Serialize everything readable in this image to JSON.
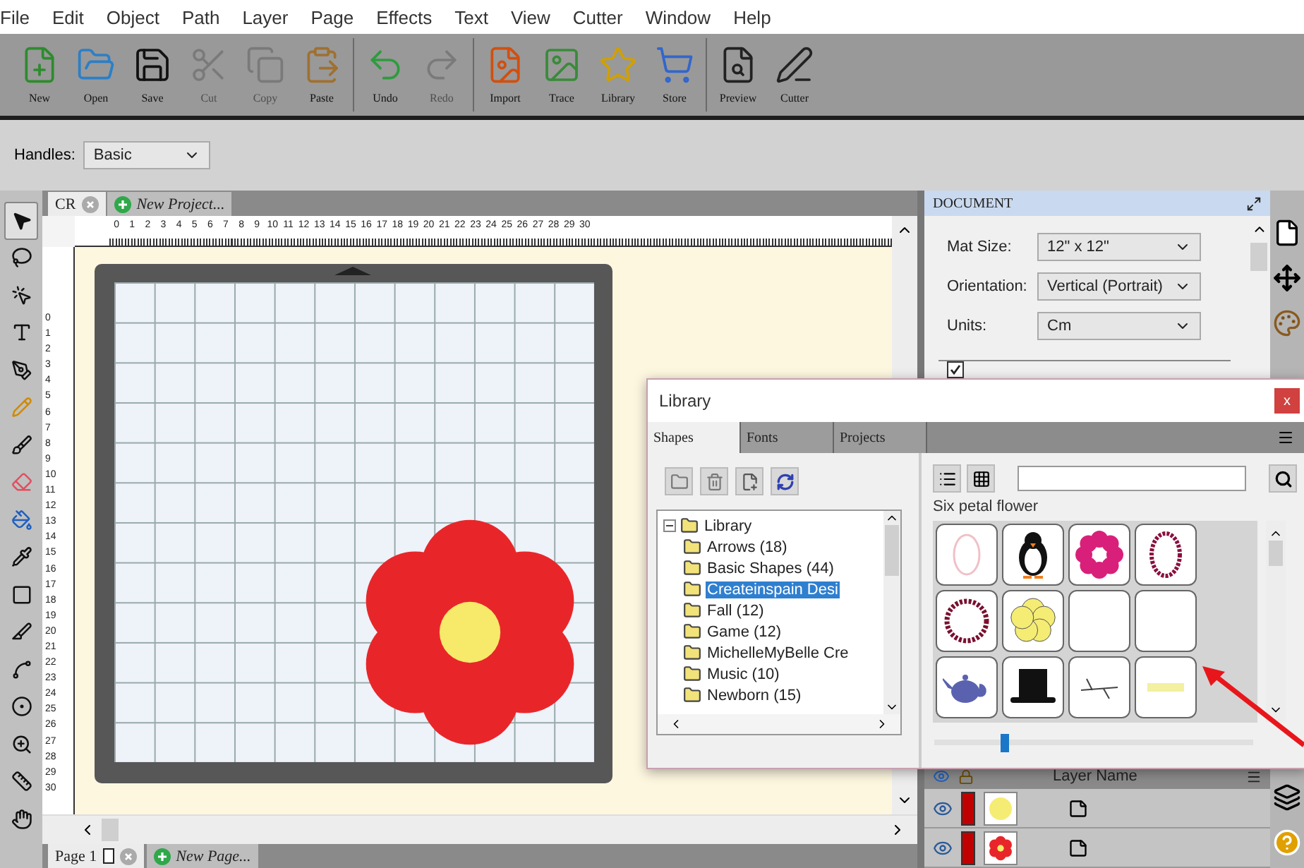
{
  "menu": [
    "File",
    "Edit",
    "Object",
    "Path",
    "Layer",
    "Page",
    "Effects",
    "Text",
    "View",
    "Cutter",
    "Window",
    "Help"
  ],
  "toolbar": {
    "groups": [
      {
        "buttons": [
          {
            "label": "New",
            "disabled": false
          },
          {
            "label": "Open",
            "disabled": false
          },
          {
            "label": "Save",
            "disabled": false
          },
          {
            "label": "Cut",
            "disabled": true
          },
          {
            "label": "Copy",
            "disabled": true
          },
          {
            "label": "Paste",
            "disabled": false
          }
        ]
      },
      {
        "buttons": [
          {
            "label": "Undo",
            "disabled": false
          },
          {
            "label": "Redo",
            "disabled": true
          }
        ]
      },
      {
        "buttons": [
          {
            "label": "Import",
            "disabled": false
          },
          {
            "label": "Trace",
            "disabled": false
          },
          {
            "label": "Library",
            "disabled": false
          },
          {
            "label": "Store",
            "disabled": false
          }
        ]
      },
      {
        "buttons": [
          {
            "label": "Preview",
            "disabled": false
          },
          {
            "label": "Cutter",
            "disabled": false
          }
        ]
      }
    ]
  },
  "handles": {
    "label": "Handles:",
    "value": "Basic"
  },
  "tools": [
    {
      "selected": true
    },
    {
      "selected": false
    },
    {
      "selected": false
    },
    {
      "selected": false
    },
    {
      "selected": false
    },
    {
      "selected": false
    },
    {
      "selected": false
    },
    {
      "selected": false
    },
    {
      "selected": false
    },
    {
      "selected": false
    },
    {
      "selected": false
    },
    {
      "selected": false
    },
    {
      "selected": false
    },
    {
      "selected": false
    },
    {
      "selected": false
    },
    {
      "selected": false
    },
    {
      "selected": false
    }
  ],
  "canvas": {
    "tabs": [
      {
        "label": "CR",
        "kind": "close",
        "selected": true
      },
      {
        "label": "New Project...",
        "kind": "new",
        "selected": false
      }
    ],
    "ruler_h": [
      "0",
      "1",
      "2",
      "3",
      "4",
      "5",
      "6",
      "7",
      "8",
      "9",
      "10",
      "11",
      "12",
      "13",
      "14",
      "15",
      "16",
      "17",
      "18",
      "19",
      "20",
      "21",
      "22",
      "23",
      "24",
      "25",
      "26",
      "27",
      "28",
      "29",
      "30"
    ],
    "ruler_v": [
      "0",
      "1",
      "2",
      "3",
      "4",
      "5",
      "6",
      "7",
      "8",
      "9",
      "10",
      "11",
      "12",
      "13",
      "14",
      "15",
      "16",
      "17",
      "18",
      "19",
      "20",
      "21",
      "22",
      "23",
      "24",
      "25",
      "26",
      "27",
      "28",
      "29",
      "30"
    ]
  },
  "page_tabs": [
    {
      "label": "Page 1",
      "kind": "close",
      "selected": true
    },
    {
      "label": "New Page...",
      "kind": "new",
      "selected": false
    }
  ],
  "document": {
    "title": "DOCUMENT",
    "fields": [
      {
        "label": "Mat Size:",
        "value": "12\" x 12\""
      },
      {
        "label": "Orientation:",
        "value": "Vertical (Portrait)"
      },
      {
        "label": "Units:",
        "value": "Cm"
      }
    ],
    "show_grid": {
      "checked": true
    }
  },
  "library": {
    "title": "Library",
    "close": "x",
    "tabs": [
      {
        "label": "Shapes",
        "selected": true
      },
      {
        "label": "Fonts",
        "selected": false
      },
      {
        "label": "Projects",
        "selected": false
      }
    ],
    "tree": {
      "label": "Library",
      "expanded": true,
      "children": [
        {
          "label": "Arrows (18)",
          "selected": false
        },
        {
          "label": "Basic Shapes (44)",
          "selected": false
        },
        {
          "label": "Createinspain Desi",
          "selected": true
        },
        {
          "label": "Fall (12)",
          "selected": false
        },
        {
          "label": "Game (12)",
          "selected": false
        },
        {
          "label": "MichelleMyBelle Cre",
          "selected": false
        },
        {
          "label": "Music (10)",
          "selected": false
        },
        {
          "label": "Newborn (15)",
          "selected": false
        }
      ]
    },
    "shape_name": "Six petal flower",
    "size_slider": {
      "level": 0.21
    }
  },
  "layers": {
    "header": "Layer Name",
    "rows": [
      {
        "kind": "circle",
        "visible": true
      },
      {
        "kind": "flower",
        "visible": true
      }
    ]
  }
}
